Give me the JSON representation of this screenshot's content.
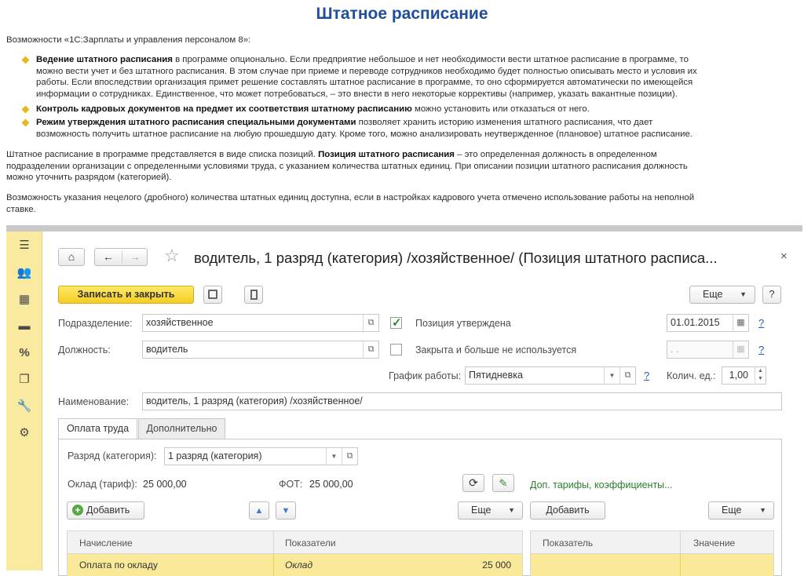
{
  "article": {
    "title": "Штатное расписание",
    "intro": "Возможности «1С:Зарплаты и управления персоналом 8»:",
    "bullets": [
      {
        "bold": "Ведение штатного расписания",
        "lines": [
          " в программе опционально. Если предприятие небольшое и нет необходимости вести штатное расписание в программе, то",
          "можно вести учет и без штатного расписания. В этом случае при приеме и переводе сотрудников необходимо будет полностью описывать место и условия их",
          "работы. Если впоследствии организация примет решение составлять штатное расписание в программе, то оно сформируется автоматически по имеющейся",
          "информации о сотрудниках. Единственное, что может потребоваться, – это внести в него некоторые коррективы (например, указать вакантные позиции)."
        ]
      },
      {
        "bold": "Контроль кадровых документов на предмет их соответствия штатному расписанию",
        "lines": [
          " можно установить или отказаться от него."
        ]
      },
      {
        "bold": "Режим утверждения штатного расписания специальными документами",
        "lines": [
          " позволяет хранить историю изменения штатного расписания, что дает",
          "возможность получить штатное расписание на любую прошедшую дату. Кроме того, можно анализировать неутвержденное (плановое) штатное расписание."
        ]
      }
    ],
    "para2": {
      "l1a": "Штатное расписание в программе представляется в виде списка позиций. ",
      "l1b": "Позиция штатного расписания",
      "l1c": " – это определенная должность в определенном",
      "l2": "подразделении организации с определенными условиями труда, с указанием количества штатных единиц. При описании позиции штатного расписания должность",
      "l3": "можно уточнить разрядом (категорией)."
    },
    "para3": {
      "l1": "Возможность указания нецелого (дробного) количества штатных единиц доступна, если в настройках кадрового учета отмечено использование работы на неполной",
      "l2": "ставке."
    }
  },
  "sidebar": {
    "icons": [
      "menu-icon",
      "users-icon",
      "calculator-icon",
      "card-icon",
      "percent-icon",
      "documents-icon",
      "wrench-icon",
      "gear-icon"
    ],
    "glyphs": [
      "☰",
      "👥",
      "▦",
      "▬",
      "%",
      "❐",
      "🔧",
      "⚙"
    ]
  },
  "window": {
    "title": "водитель, 1 разряд (категория) /хозяйственное/ (Позиция штатного расписа...",
    "nav": {
      "home": "⌂",
      "back": "←",
      "forward": "→",
      "star": "☆",
      "close": "×"
    },
    "toolbar": {
      "save_close": "Записать и закрыть",
      "more": "Еще",
      "help": "?"
    },
    "fields": {
      "division_label": "Подразделение:",
      "division_value": "хозяйственное",
      "position_label": "Должность:",
      "position_value": "водитель",
      "approved_label": "Позиция утверждена",
      "approved_checked": true,
      "approved_date": "01.01.2015",
      "closed_label": "Закрыта и больше не используется",
      "closed_checked": false,
      "closed_date": " .  .",
      "schedule_label": "График работы:",
      "schedule_value": "Пятидневка",
      "units_label": "Колич. ед.:",
      "units_value": "1,00",
      "name_label": "Наименование:",
      "name_value": "водитель, 1 разряд (категория) /хозяйственное/",
      "q": "?"
    },
    "tabs": [
      {
        "label": "Оплата труда",
        "active": true
      },
      {
        "label": "Дополнительно",
        "active": false
      }
    ],
    "pay": {
      "grade_label": "Разряд (категория):",
      "grade_value": "1 разряд (категория)",
      "salary_label": "Оклад (тариф):",
      "salary_value": "25 000,00",
      "fot_label": "ФОТ:",
      "fot_value": "25 000,00",
      "extra_link": "Доп. тарифы, коэффициенты...",
      "add_label": "Добавить",
      "more_label": "Еще",
      "add2_label": "Добавить",
      "more2_label": "Еще",
      "grid1": {
        "columns": [
          "Начисление",
          "Показатели"
        ],
        "rows": [
          {
            "accrual": "Оплата по окладу",
            "indicator": "Оклад",
            "amount": "25 000"
          }
        ]
      },
      "grid2": {
        "columns": [
          "Показатель",
          "Значение"
        ]
      }
    }
  }
}
